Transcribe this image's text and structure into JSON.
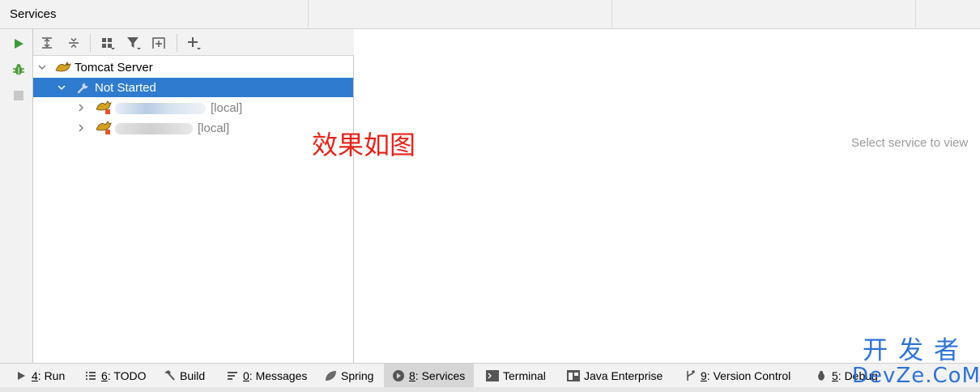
{
  "header": {
    "title": "Services"
  },
  "left_toolbar": {
    "buttons": [
      {
        "icon": "run-icon",
        "color": "#3c9a3c"
      },
      {
        "icon": "debug-icon",
        "color": "#4e9a3a"
      },
      {
        "icon": "stop-icon",
        "color": "#c7c7c7"
      }
    ]
  },
  "top_toolbar": {
    "buttons": [
      {
        "icon": "expand-all-icon"
      },
      {
        "icon": "collapse-all-icon"
      },
      {
        "icon": "group-by-icon"
      },
      {
        "icon": "filter-icon"
      },
      {
        "icon": "new-tab-icon"
      },
      {
        "icon": "add-service-icon"
      }
    ]
  },
  "tree": {
    "root": {
      "label": "Tomcat Server",
      "icon": "tomcat-icon"
    },
    "group": {
      "label": "Not Started",
      "icon": "wrench-icon"
    },
    "children": [
      {
        "suffix": "[local]",
        "icon": "tomcat-config-icon"
      },
      {
        "suffix": "[local]",
        "icon": "tomcat-config-icon"
      }
    ]
  },
  "annotation": "效果如图",
  "right_panel": {
    "empty_text": "Select service to view"
  },
  "bottom_tabs": [
    {
      "mnemonic": "4",
      "label": ": Run",
      "icon": "run-tab-icon",
      "active": false
    },
    {
      "mnemonic": "6",
      "label": ": TODO",
      "icon": "todo-icon",
      "active": false
    },
    {
      "mnemonic": "",
      "label": "Build",
      "icon": "hammer-icon",
      "active": false
    },
    {
      "mnemonic": "0",
      "label": ": Messages",
      "icon": "messages-icon",
      "active": false
    },
    {
      "mnemonic": "",
      "label": "Spring",
      "icon": "spring-icon",
      "active": false
    },
    {
      "mnemonic": "8",
      "label": ": Services",
      "icon": "services-icon",
      "active": true
    },
    {
      "mnemonic": "",
      "label": "Terminal",
      "icon": "terminal-icon",
      "active": false
    },
    {
      "mnemonic": "",
      "label": "Java Enterprise",
      "icon": "java-enterprise-icon",
      "active": false
    },
    {
      "mnemonic": "9",
      "label": ": Version Control",
      "icon": "vcs-icon",
      "active": false
    },
    {
      "mnemonic": "5",
      "label": ": Debug",
      "icon": "debug-tab-icon",
      "active": false
    }
  ],
  "watermark": {
    "line1": "开发者",
    "line2": "DevZe.CoM"
  },
  "colors": {
    "selection": "#2e7bcf",
    "annotation": "#e8231a",
    "watermark": "#2f73d8"
  }
}
